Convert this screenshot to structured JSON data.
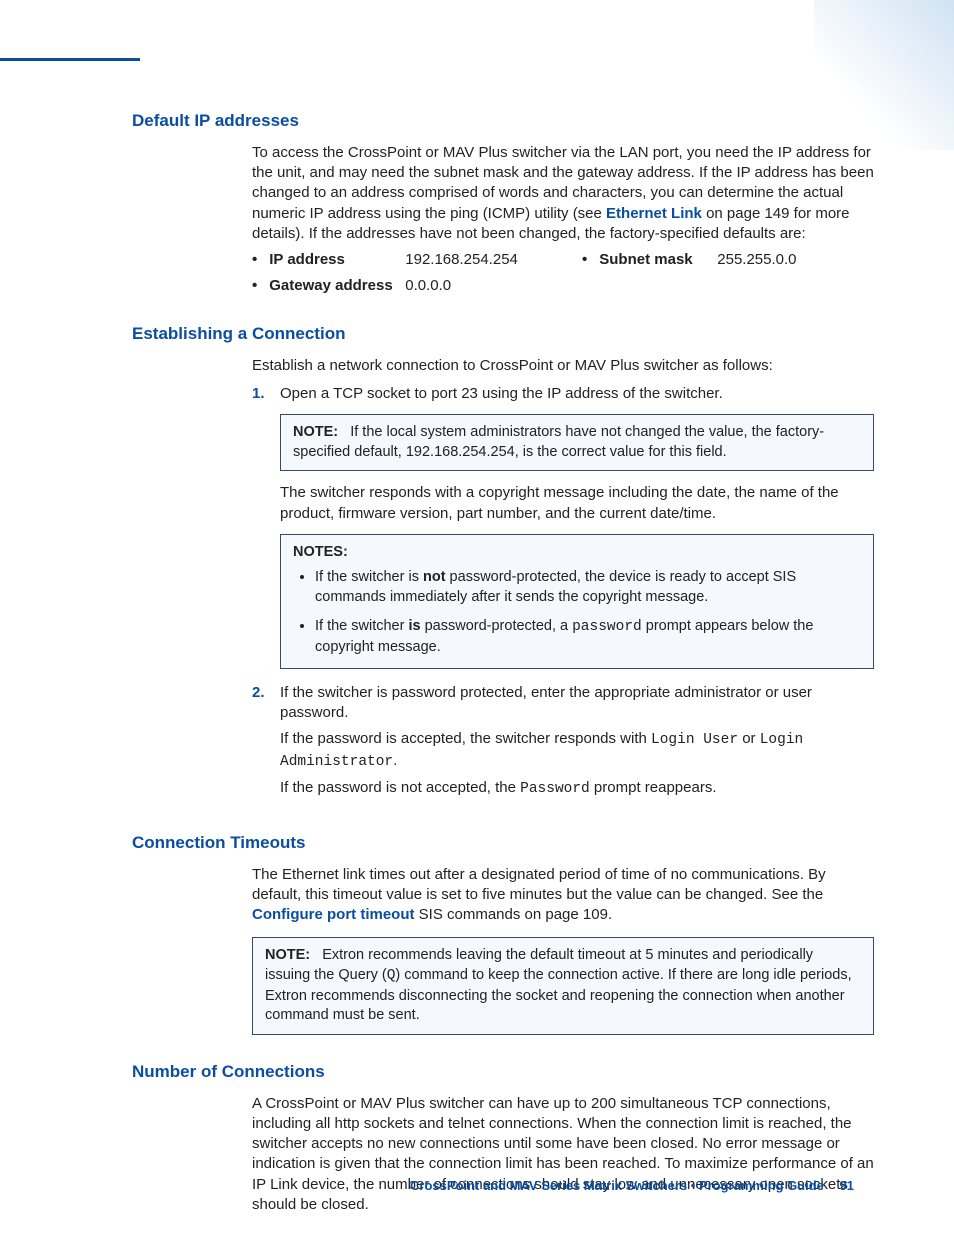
{
  "sections": {
    "defaultIP": {
      "title": "Default IP addresses",
      "para_before_link": "To access the CrossPoint or MAV Plus switcher via the LAN port, you need the IP address for the unit, and may need the subnet mask and the gateway address. If the IP address has been changed to an address comprised of words and characters, you can determine the actual numeric IP address using the ping (ICMP) utility (see ",
      "link_text": "Ethernet Link",
      "para_after_link": " on page 149 for more details). If the addresses have not been changed, the factory-specified defaults are:",
      "items": {
        "ip_label": "IP address",
        "ip_value": "192.168.254.254",
        "subnet_label": "Subnet mask",
        "subnet_value": "255.255.0.0",
        "gateway_label": "Gateway address",
        "gateway_value": "0.0.0.0"
      }
    },
    "establishing": {
      "title": "Establishing a Connection",
      "intro": "Establish a network connection to CrossPoint or MAV Plus switcher as follows:",
      "step1_num": "1.",
      "step1_text": "Open a TCP socket to port 23 using the IP address of the switcher.",
      "note1_label": "NOTE:",
      "note1_text": "If the local system administrators have not changed the value, the factory-specified default, 192.168.254.254, is the correct value for this field.",
      "after_note1": "The switcher responds with a copyright message including the date, the name of the product, firmware version, part number, and the current date/time.",
      "notes2_label": "NOTES:",
      "notes2_b1_a": "If the switcher is ",
      "notes2_b1_bold": "not",
      "notes2_b1_b": " password-protected, the device is ready to accept SIS commands immediately after it sends the copyright message.",
      "notes2_b2_a": "If the switcher ",
      "notes2_b2_bold": "is",
      "notes2_b2_b": " password-protected, a ",
      "notes2_b2_mono": "password",
      "notes2_b2_c": " prompt appears below the copyright message.",
      "step2_num": "2.",
      "step2_text": "If the switcher is password protected, enter the appropriate administrator or user password.",
      "step2_p2_a": "If the password is accepted, the switcher responds with ",
      "step2_p2_mono1": "Login User",
      "step2_p2_b": " or ",
      "step2_p2_mono2": "Login Administrator",
      "step2_p2_c": ".",
      "step2_p3_a": "If the password is not accepted, the ",
      "step2_p3_mono": "Password",
      "step2_p3_b": " prompt reappears."
    },
    "timeouts": {
      "title": "Connection Timeouts",
      "para_a": "The Ethernet link times out after a designated period of time of no communications. By default, this timeout value is set to five minutes but the value can be changed. See the ",
      "link_text": "Configure port timeout",
      "para_b": " SIS commands on page 109.",
      "note_label": "NOTE:",
      "note_a": "Extron recommends leaving the default timeout at 5 minutes and periodically issuing the Query (",
      "note_mono": "Q",
      "note_b": ") command to keep the connection active. If there are long idle periods, Extron recommends disconnecting the socket and reopening the connection when another command must be sent."
    },
    "numConn": {
      "title": "Number of Connections",
      "para": "A CrossPoint or MAV Plus switcher can have up to 200 simultaneous TCP connections, including all http sockets and telnet connections. When the connection limit is reached, the switcher accepts no new connections until some have been closed. No error message or indication is given that the connection limit has been reached. To maximize performance of an IP Link device, the number of connections should stay low and unnecessary open sockets should be closed."
    }
  },
  "footer": {
    "text": "CrossPoint and MAV Series Matrix Switchers • Programming Guide",
    "page": "91"
  }
}
